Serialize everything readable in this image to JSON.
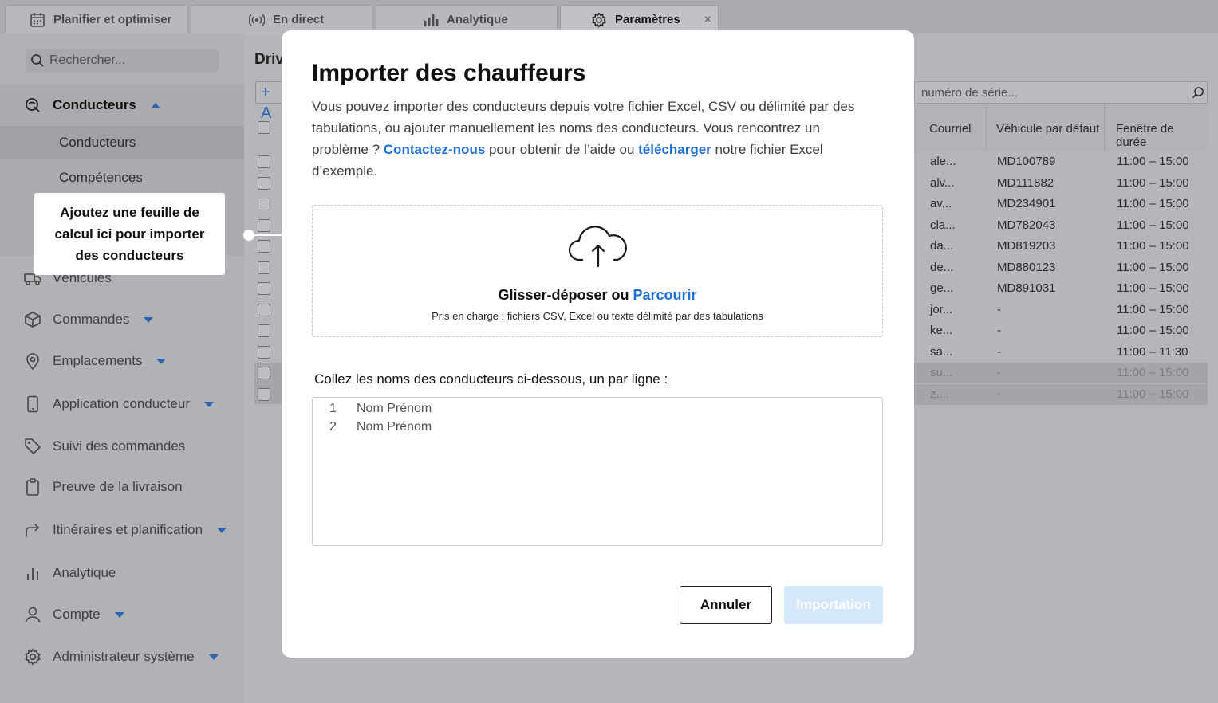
{
  "tabs": [
    {
      "label": "Planifier et optimiser",
      "icon": "calendar-icon"
    },
    {
      "label": "En direct",
      "icon": "broadcast-icon"
    },
    {
      "label": "Analytique",
      "icon": "bar-chart-icon"
    },
    {
      "label": "Paramètres",
      "icon": "gear-icon",
      "active": true
    }
  ],
  "tab_close": "×",
  "sidebar": {
    "search_placeholder": "Rechercher...",
    "group_label": "Conducteurs",
    "sub_items": [
      "Conducteurs",
      "Compétences"
    ],
    "items": [
      {
        "label": "Véhicules",
        "icon": "truck-icon"
      },
      {
        "label": "Commandes",
        "icon": "box-icon"
      },
      {
        "label": "Emplacements",
        "icon": "location-pin-icon"
      },
      {
        "label": "Application conducteur",
        "icon": "phone-icon"
      },
      {
        "label": "Suivi des commandes",
        "icon": "tag-icon"
      },
      {
        "label": "Preuve de la livraison",
        "icon": "clipboard-icon"
      },
      {
        "label": "Itinéraires et planification",
        "icon": "route-arrow-icon"
      },
      {
        "label": "Analytique",
        "icon": "bar-chart-icon"
      },
      {
        "label": "Compte",
        "icon": "user-icon"
      },
      {
        "label": "Administrateur système",
        "icon": "gear-icon"
      }
    ]
  },
  "callout": {
    "text": "Ajoutez une feuille de calcul ici pour importer des conducteurs"
  },
  "content": {
    "title": "Driv",
    "add_label": "+ A",
    "serial_placeholder": "numéro de série...",
    "columns": [
      "Courriel",
      "Véhicule par défaut",
      "Fenêtre de durée"
    ],
    "rows": [
      [
        "ale...",
        "MD100789",
        "11:00 – 15:00"
      ],
      [
        "alv...",
        "MD111882",
        "11:00 – 15:00"
      ],
      [
        "av...",
        "MD234901",
        "11:00 – 15:00"
      ],
      [
        "cla...",
        "MD782043",
        "11:00 – 15:00"
      ],
      [
        "da...",
        "MD819203",
        "11:00 – 15:00"
      ],
      [
        "de...",
        "MD880123",
        "11:00 – 15:00"
      ],
      [
        "ge...",
        "MD891031",
        "11:00 – 15:00"
      ],
      [
        "jor...",
        "-",
        "11:00 – 15:00"
      ],
      [
        "ke...",
        "-",
        "11:00 – 15:00"
      ],
      [
        "sa...",
        "-",
        "11:00 – 11:30"
      ],
      [
        "su...",
        "-",
        "11:00 – 15:00"
      ],
      [
        "z....",
        "-",
        "11:00 – 15:00"
      ]
    ]
  },
  "modal": {
    "title": "Importer des chauffeurs",
    "desc_part1": "Vous pouvez importer des conducteurs depuis votre fichier Excel, CSV ou délimité par des tabulations, ou ajouter manuellement les noms des conducteurs. Vous rencontrez un problème ? ",
    "contact_link": "Contactez-nous",
    "desc_part2": " pour obtenir de l’aide ou ",
    "download_link": "télécharger",
    "desc_part3": " notre fichier Excel d’exemple.",
    "drop_main": "Glisser-déposer ou ",
    "drop_browse": "Parcourir",
    "drop_sub": "Pris en charge : fichiers CSV, Excel ou texte délimité par des tabulations",
    "paste_label": "Collez les noms des conducteurs ci-dessous, un par ligne :",
    "editor_lines": [
      {
        "num": "1",
        "text": "Nom Prénom"
      },
      {
        "num": "2",
        "text": "Nom Prénom"
      }
    ],
    "cancel_label": "Annuler",
    "import_label": "Importation"
  }
}
